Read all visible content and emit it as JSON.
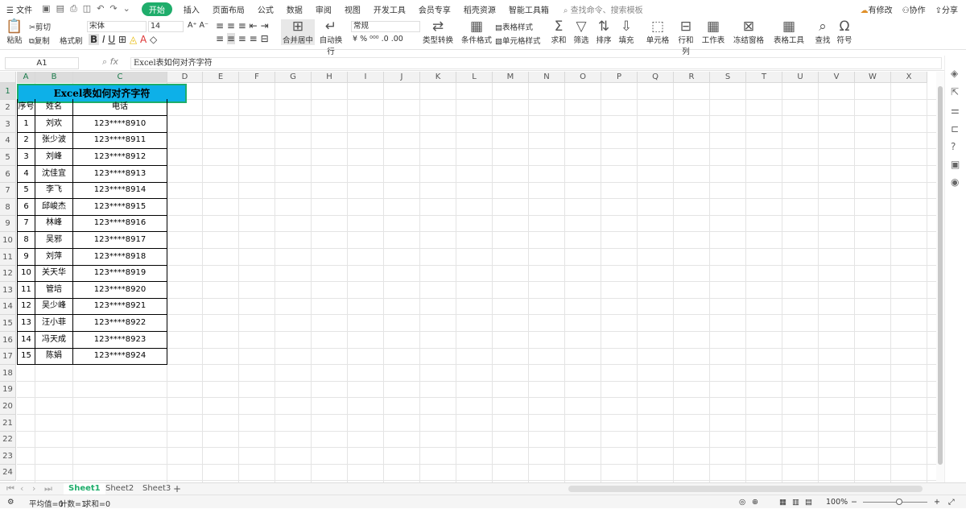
{
  "menubar": {
    "menu_icon": "☰",
    "file": "文件",
    "start": "开始",
    "items": [
      "插入",
      "页面布局",
      "公式",
      "数据",
      "审阅",
      "视图",
      "开发工具",
      "会员专享",
      "稻壳资源",
      "智能工具箱"
    ],
    "search": "查找命令、搜索模板",
    "right": [
      "有修改",
      "协作",
      "分享"
    ]
  },
  "toolbar": {
    "paste": "粘贴",
    "cut": "剪切",
    "copy": "复制",
    "format_painter": "格式刷",
    "font_name": "宋体",
    "font_size": "14",
    "merge": "合并居中",
    "wrap": "自动换行",
    "number_format": "常规",
    "type_convert": "类型转换",
    "cond_format": "条件格式",
    "table_style": "表格样式",
    "cell_style": "单元格样式",
    "sum": "求和",
    "filter": "筛选",
    "sort": "排序",
    "fill": "填充",
    "cells": "单元格",
    "rowcol": "行和列",
    "worksheet": "工作表",
    "freeze": "冻结窗格",
    "table_tools": "表格工具",
    "find": "查找",
    "symbol": "符号"
  },
  "formula": {
    "cell_ref": "A1",
    "fx": "fx",
    "content": "Excel表如何对齐字符"
  },
  "grid": {
    "columns": [
      "A",
      "B",
      "C",
      "D",
      "E",
      "F",
      "G",
      "H",
      "I",
      "J",
      "K",
      "L",
      "M",
      "N",
      "O",
      "P",
      "Q",
      "R",
      "S",
      "T",
      "U",
      "V",
      "W",
      "X"
    ],
    "row_numbers": [
      "1",
      "2",
      "3",
      "4",
      "5",
      "6",
      "7",
      "8",
      "9",
      "10",
      "11",
      "12",
      "13",
      "14",
      "15",
      "16",
      "17",
      "18",
      "19",
      "20",
      "21",
      "22",
      "23",
      "24"
    ],
    "title": "Excel表如何对齐字符",
    "headers": [
      "序号",
      "姓名",
      "电话"
    ],
    "rows": [
      [
        "1",
        "刘欢",
        "123****8910"
      ],
      [
        "2",
        "张少波",
        "123****8911"
      ],
      [
        "3",
        "刘峰",
        "123****8912"
      ],
      [
        "4",
        "沈佳宜",
        "123****8913"
      ],
      [
        "5",
        "李飞",
        "123****8914"
      ],
      [
        "6",
        "邱峻杰",
        "123****8915"
      ],
      [
        "7",
        "林峰",
        "123****8916"
      ],
      [
        "8",
        "吴邪",
        "123****8917"
      ],
      [
        "9",
        "刘萍",
        "123****8918"
      ],
      [
        "10",
        "关天华",
        "123****8919"
      ],
      [
        "11",
        "管培",
        "123****8920"
      ],
      [
        "12",
        "吴少峰",
        "123****8921"
      ],
      [
        "13",
        "汪小菲",
        "123****8922"
      ],
      [
        "14",
        "冯天成",
        "123****8923"
      ],
      [
        "15",
        "陈娟",
        "123****8924"
      ]
    ]
  },
  "sheets": {
    "tabs": [
      "Sheet1",
      "Sheet2",
      "Sheet3"
    ],
    "active": "Sheet1",
    "add": "+"
  },
  "status": {
    "avg": "平均值=0",
    "count": "计数=1",
    "sum": "求和=0",
    "zoom": "100%"
  },
  "colors": {
    "accent": "#1fad6b",
    "title_fill": "#0db0e8"
  }
}
